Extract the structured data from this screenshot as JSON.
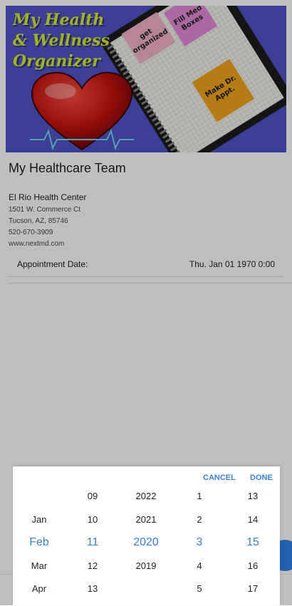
{
  "banner": {
    "title_lines": [
      "My Health",
      "& Wellness",
      "Organizer"
    ],
    "notes": [
      "get organized",
      "Fill Med Boxes",
      "Make Dr. Appt."
    ]
  },
  "page": {
    "heading": "My Healthcare Team"
  },
  "provider": {
    "name": "El Rio Health Center",
    "address_line1": "1501 W. Commerce Ct",
    "address_line2": "Tucson, AZ, 85746",
    "phone": "520-670-3909",
    "website": "www.nextmd.com"
  },
  "appointment": {
    "label": "Appointment Date:",
    "value": "Thu. Jan 01 1970 0:00"
  },
  "picker": {
    "cancel_label": "CANCEL",
    "done_label": "DONE",
    "months": [
      "",
      "Jan",
      "Feb",
      "Mar",
      "Apr"
    ],
    "days": [
      "09",
      "10",
      "11",
      "12",
      "13"
    ],
    "years": [
      "2022",
      "2021",
      "2020",
      "2019",
      ""
    ],
    "hours": [
      "1",
      "2",
      "3",
      "4",
      "5"
    ],
    "minutes": [
      "13",
      "14",
      "15",
      "16",
      "17"
    ],
    "selected_index": 2
  },
  "colors": {
    "accent": "#3b82d8",
    "banner_bg": "#4f56c9",
    "banner_title": "#d7f01f",
    "fab": "#2f80ed"
  }
}
